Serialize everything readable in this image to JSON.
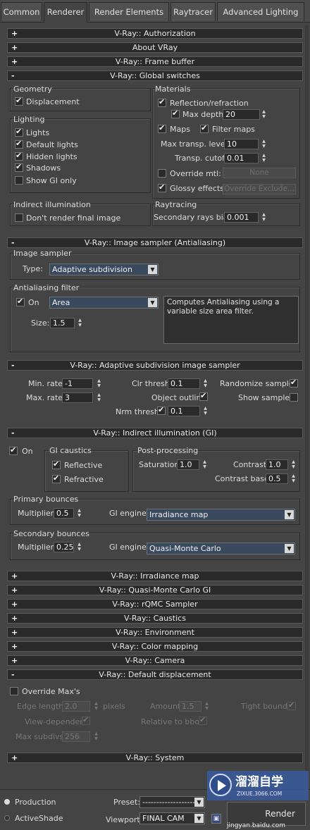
{
  "tabs": [
    "Common",
    "Renderer",
    "Render Elements",
    "Raytracer",
    "Advanced Lighting"
  ],
  "rollouts": {
    "authorization": {
      "sign": "+",
      "title": "V-Ray:: Authorization"
    },
    "about": {
      "sign": "+",
      "title": "About VRay"
    },
    "frame_buffer": {
      "sign": "+",
      "title": "V-Ray:: Frame buffer"
    },
    "global_switches": {
      "sign": "-",
      "title": "V-Ray:: Global switches"
    },
    "image_sampler": {
      "sign": "-",
      "title": "V-Ray:: Image sampler (Antialiasing)"
    },
    "adaptive": {
      "sign": "-",
      "title": "V-Ray:: Adaptive subdivision image sampler"
    },
    "gi": {
      "sign": "-",
      "title": "V-Ray:: Indirect illumination (GI)"
    },
    "irradiance": {
      "sign": "+",
      "title": "V-Ray:: Irradiance map"
    },
    "qmc_gi": {
      "sign": "+",
      "title": "V-Ray:: Quasi-Monte Carlo GI"
    },
    "rqmc": {
      "sign": "+",
      "title": "V-Ray:: rQMC Sampler"
    },
    "caustics": {
      "sign": "+",
      "title": "V-Ray:: Caustics"
    },
    "environment": {
      "sign": "+",
      "title": "V-Ray:: Environment"
    },
    "color_mapping": {
      "sign": "+",
      "title": "V-Ray:: Color mapping"
    },
    "camera": {
      "sign": "+",
      "title": "V-Ray:: Camera"
    },
    "default_displacement": {
      "sign": "-",
      "title": "V-Ray:: Default displacement"
    },
    "system": {
      "sign": "+",
      "title": "V-Ray:: System"
    }
  },
  "global_switches": {
    "geometry_title": "Geometry",
    "displacement": "Displacement",
    "lighting_title": "Lighting",
    "lights": "Lights",
    "default_lights": "Default lights",
    "hidden_lights": "Hidden lights",
    "shadows": "Shadows",
    "show_gi_only": "Show GI only",
    "indirect_title": "Indirect illumination",
    "dont_render": "Don't render final image",
    "materials_title": "Materials",
    "reflection_refraction": "Reflection/refraction",
    "max_depth_label": "Max depth",
    "max_depth_value": "20",
    "maps": "Maps",
    "filter_maps": "Filter maps",
    "max_transp_label": "Max transp. levels",
    "max_transp_value": "10",
    "transp_cutoff_label": "Transp. cutoff",
    "transp_cutoff_value": "0.01",
    "override_mtl": "Override mtl:",
    "override_mtl_button": "None",
    "glossy_effects": "Glossy effects",
    "override_exclude_button": "Override Exclude...",
    "raytracing_title": "Raytracing",
    "secondary_bias_label": "Secondary rays bias",
    "secondary_bias_value": "0.001"
  },
  "image_sampler": {
    "group_title": "Image sampler",
    "type_label": "Type:",
    "type_value": "Adaptive subdivision",
    "aa_title": "Antialiasing filter",
    "on_label": "On",
    "filter_value": "Area",
    "filter_description": "Computes Antialiasing using a variable size area filter.",
    "size_label": "Size:",
    "size_value": "1.5"
  },
  "adaptive": {
    "min_rate_label": "Min. rate:",
    "min_rate_value": "-1",
    "max_rate_label": "Max. rate:",
    "max_rate_value": "3",
    "clr_thresh_label": "Clr thresh:",
    "clr_thresh_value": "0.1",
    "object_outline": "Object outline",
    "nrm_thresh_label": "Nrm thresh:",
    "nrm_thresh_value": "0.1",
    "randomize_samples": "Randomize samples",
    "show_samples": "Show samples"
  },
  "gi": {
    "on_label": "On",
    "caustics_title": "GI caustics",
    "reflective": "Reflective",
    "refractive": "Refractive",
    "post_title": "Post-processing",
    "saturation_label": "Saturation:",
    "saturation_value": "1.0",
    "contrast_label": "Contrast:",
    "contrast_value": "1.0",
    "contrast_base_label": "Contrast base:",
    "contrast_base_value": "0.5",
    "primary_title": "Primary bounces",
    "primary_multiplier_label": "Multiplier:",
    "primary_multiplier_value": "0.5",
    "primary_engine_label": "GI engine:",
    "primary_engine_value": "Irradiance map",
    "secondary_title": "Secondary bounces",
    "secondary_multiplier_label": "Multiplier:",
    "secondary_multiplier_value": "0.25",
    "secondary_engine_label": "GI engine:",
    "secondary_engine_value": "Quasi-Monte Carlo"
  },
  "displacement": {
    "override_max": "Override Max's",
    "edge_length_label": "Edge length",
    "edge_length_value": "2.0",
    "pixels_label": "pixels",
    "amount_label": "Amount",
    "amount_value": "1.5",
    "tight_bounds": "Tight bounds",
    "view_dependent": "View-dependent",
    "relative_bbox": "Relative to bbox",
    "max_subdivs_label": "Max subdivs",
    "max_subdivs_value": "256"
  },
  "footer": {
    "production": "Production",
    "activeshade": "ActiveShade",
    "preset_label": "Preset:",
    "preset_value": "--------------------",
    "viewport_label": "Viewport:",
    "viewport_value": "FINAL CAM",
    "render_button": "Render"
  },
  "watermark": {
    "site_name": "溜溜自学",
    "site_domain": "ZIXUE.3066.COM",
    "url": "jingyan.baidu.com"
  }
}
